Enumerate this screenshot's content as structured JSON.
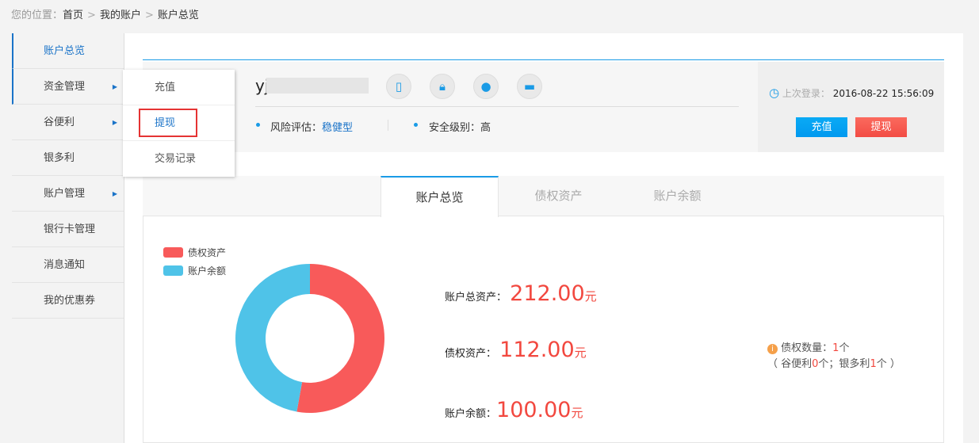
{
  "breadcrumb": {
    "prefix": "您的位置：",
    "items": [
      "首页",
      "我的账户",
      "账户总览"
    ],
    "separator": ">"
  },
  "sidebar": {
    "items": [
      {
        "label": "账户总览",
        "active": true
      },
      {
        "label": "资金管理",
        "submenu": true
      },
      {
        "label": "谷便利",
        "submenu": true
      },
      {
        "label": "银多利"
      },
      {
        "label": "账户管理",
        "submenu": true
      },
      {
        "label": "银行卡管理"
      },
      {
        "label": "消息通知"
      },
      {
        "label": "我的优惠券"
      }
    ]
  },
  "dropdown": {
    "items": [
      "充值",
      "提现",
      "交易记录"
    ],
    "highlighted": "提现"
  },
  "user": {
    "name": "yj",
    "icons": [
      "phone-icon",
      "lock-icon",
      "user-icon",
      "card-icon"
    ],
    "risk_label": "风险评估：",
    "risk_value": "稳健型",
    "security_label": "安全级别：",
    "security_value": "高"
  },
  "login": {
    "label": "上次登录：",
    "time": "2016-08-22 15:56:09"
  },
  "buttons": {
    "recharge": "充值",
    "withdraw": "提现"
  },
  "tabs": [
    "账户总览",
    "债权资产",
    "账户余额"
  ],
  "colors": {
    "accent": "#1a9be6",
    "red": "#f85a5a",
    "blue": "#4fc3e8",
    "amount": "#f2483f"
  },
  "chart_data": {
    "type": "pie",
    "donut": true,
    "categories": [
      "债权资产",
      "账户余额"
    ],
    "values": [
      112,
      100
    ],
    "colors": [
      "#f85a5a",
      "#4fc3e8"
    ],
    "legend": "top-left"
  },
  "summary": {
    "unit": "元",
    "total_label": "账户总资产：",
    "total": "212.00",
    "debt_label": "债权资产：",
    "debt": "112.00",
    "balance_label": "账户余额：",
    "balance": "100.00"
  },
  "note": {
    "count_label": "债权数量：",
    "count": "1",
    "unit": "个",
    "open": "（ 谷便利",
    "gbl": "0",
    "mid": "个；银多利",
    "ydl": "1",
    "close": "个 ）"
  }
}
